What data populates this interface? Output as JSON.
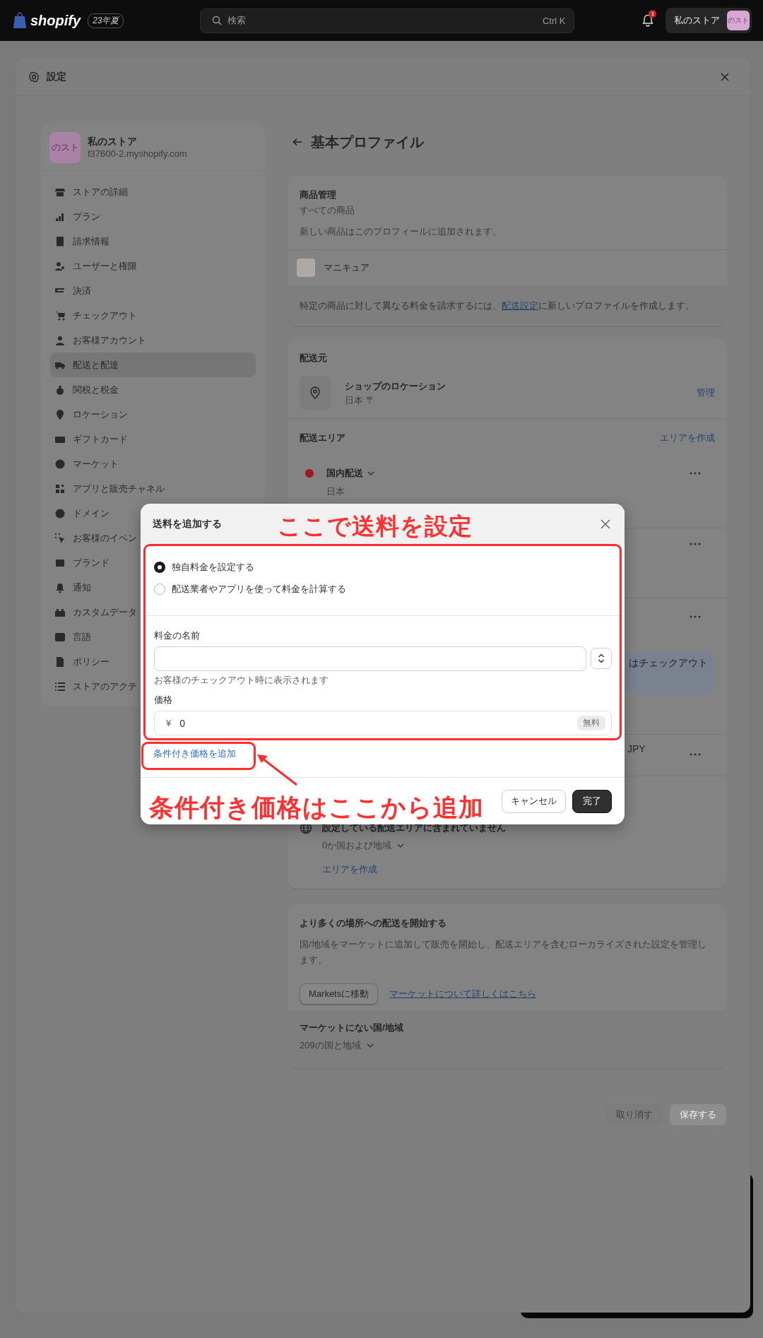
{
  "top_bar": {
    "logo": "shopify",
    "edition": "23年夏",
    "search": {
      "placeholder": "検索",
      "shortcut": "Ctrl K"
    },
    "notification_count": "1",
    "store": {
      "name": "私のストア",
      "avatar": "のスト"
    }
  },
  "settings": {
    "title": "設定"
  },
  "sidebar": {
    "store": {
      "name": "私のストア",
      "domain": "f37600-2.myshopify.com",
      "avatar": "のスト"
    },
    "items": [
      {
        "label": "ストアの詳細",
        "selected": false
      },
      {
        "label": "プラン",
        "selected": false
      },
      {
        "label": "請求情報",
        "selected": false
      },
      {
        "label": "ユーザーと権限",
        "selected": false
      },
      {
        "label": "決済",
        "selected": false
      },
      {
        "label": "チェックアウト",
        "selected": false
      },
      {
        "label": "お客様アカウント",
        "selected": false
      },
      {
        "label": "配送と配達",
        "selected": true
      },
      {
        "label": "関税と税金",
        "selected": false
      },
      {
        "label": "ロケーション",
        "selected": false
      },
      {
        "label": "ギフトカード",
        "selected": false
      },
      {
        "label": "マーケット",
        "selected": false
      },
      {
        "label": "アプリと販売チャネル",
        "selected": false
      },
      {
        "label": "ドメイン",
        "selected": false
      },
      {
        "label": "お客様のイベン",
        "selected": false
      },
      {
        "label": "ブランド",
        "selected": false
      },
      {
        "label": "通知",
        "selected": false
      },
      {
        "label": "カスタムデータ",
        "selected": false
      },
      {
        "label": "言語",
        "selected": false
      },
      {
        "label": "ポリシー",
        "selected": false
      },
      {
        "label": "ストアのアクテ",
        "selected": false
      }
    ]
  },
  "page": {
    "title": "基本プロファイル"
  },
  "products_card": {
    "heading": "商品管理",
    "subheading": "すべての商品",
    "note": "新しい商品はこのプロフィールに追加されます。",
    "product": "マニキュア",
    "footer": {
      "before": "特定の商品に対して異なる料金を請求するには、",
      "link": "配送設定",
      "after": "に新しいプロファイルを作成します。"
    }
  },
  "origin_card": {
    "heading": "配送元",
    "location": {
      "name": "ショップのロケーション",
      "address": "日本 〒",
      "action": "管理"
    },
    "zones_heading": "配送エリア",
    "zones_action": "エリアを作成",
    "zone": {
      "name": "国内配送",
      "country": "日本",
      "color": "#a3161a"
    },
    "hidden_rows": [
      {
        "kind": "menu"
      },
      {
        "kind": "banner",
        "text": "はチェックアウト"
      },
      {
        "kind": "rate",
        "text": "JPY"
      }
    ],
    "excluded": {
      "title": "設定している配送エリアに含まれていません",
      "count": "0か国および地域",
      "action": "エリアを作成"
    }
  },
  "markets_card": {
    "title": "より多くの場所への配送を開始する",
    "body": "国/地域をマーケットに追加して販売を開始し、配送エリアを含むローカライズされた設定を管理します。",
    "button": "Marketsに移動",
    "link": "マーケットについて詳しくはこちら",
    "unlisted_heading": "マーケットにない国/地域",
    "unlisted_count": "209の国と地域"
  },
  "footer_buttons": [
    {
      "label": "取り消す",
      "kind": "secondary",
      "disabled": true
    },
    {
      "label": "保存する",
      "kind": "primary",
      "disabled": true
    }
  ],
  "modal": {
    "title": "送料を追加する",
    "options": [
      {
        "label": "独自料金を設定する",
        "selected": true
      },
      {
        "label": "配送業者やアプリを使って料金を計算する",
        "selected": false
      }
    ],
    "name_field": {
      "label": "料金の名前",
      "hint": "お客様のチェックアウト時に表示されます"
    },
    "price_field": {
      "label": "価格",
      "currency": "¥",
      "value": "0",
      "badge": "無料"
    },
    "add_link": "条件付き価格を追加",
    "buttons": [
      {
        "label": "キャンセル",
        "kind": "secondary"
      },
      {
        "label": "完了",
        "kind": "primary"
      }
    ]
  },
  "annotations": [
    {
      "text": "ここで送料を設定"
    },
    {
      "text": "条件付き価格はここから追加"
    }
  ]
}
